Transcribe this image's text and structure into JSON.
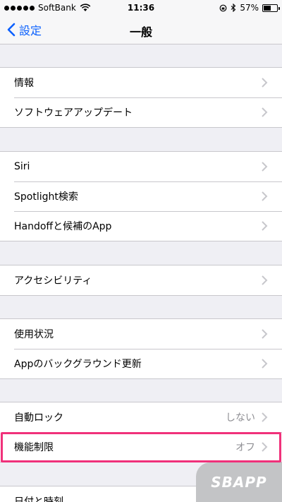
{
  "status": {
    "carrier": "SoftBank",
    "time": "11:36",
    "battery": "57%",
    "battery_level": 0.57
  },
  "nav": {
    "back_label": "設定",
    "title": "一般"
  },
  "groups": [
    {
      "items": [
        {
          "label": "情報"
        },
        {
          "label": "ソフトウェアアップデート"
        }
      ]
    },
    {
      "items": [
        {
          "label": "Siri"
        },
        {
          "label": "Spotlight検索"
        },
        {
          "label": "Handoffと候補のApp"
        }
      ]
    },
    {
      "items": [
        {
          "label": "アクセシビリティ"
        }
      ]
    },
    {
      "items": [
        {
          "label": "使用状況"
        },
        {
          "label": "Appのバックグラウンド更新"
        }
      ]
    },
    {
      "items": [
        {
          "label": "自動ロック",
          "value": "しない"
        },
        {
          "label": "機能制限",
          "value": "オフ"
        }
      ]
    },
    {
      "items": [
        {
          "label": "日付と時刻"
        }
      ]
    }
  ],
  "watermark": "SBAPP",
  "colors": {
    "accent": "#0a60fe",
    "highlight": "#f0317a"
  }
}
